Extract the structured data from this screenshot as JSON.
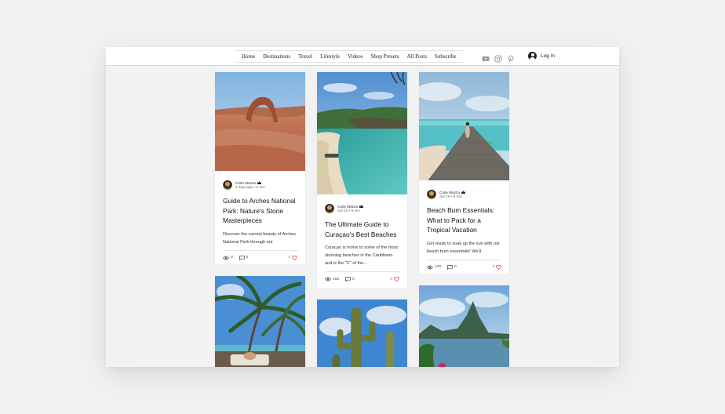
{
  "nav": {
    "items": [
      "Home",
      "Destinations",
      "Travel",
      "Lifestyle",
      "Videos",
      "Shop Presets",
      "All Posts",
      "Subscribe"
    ]
  },
  "social": [
    "youtube-icon",
    "instagram-icon",
    "pinterest-icon"
  ],
  "login": {
    "label": "Log In"
  },
  "posts": [
    {
      "author": "Corie Mazza",
      "date": "4 days ago",
      "read_time": "6 min",
      "title": "Guide to Arches National Park: Nature's Stone Masterpieces",
      "excerpt": "Discover the surreal beauty of Arches National Park through our",
      "views": "0",
      "comments": "0",
      "likes": "2"
    },
    {
      "author": "Corie Mazza",
      "date": "Apr 16",
      "read_time": "6 min",
      "title": "The Ultimate Guide to Curaçao's Best Beaches",
      "excerpt": "Curacao is home to some of the most stunning beaches in the Caribbean and is the \"C\" of the...",
      "views": "405",
      "comments": "0",
      "likes": "3"
    },
    {
      "author": "Corie Mazza",
      "date": "Apr 16",
      "read_time": "5 min",
      "title": "Beach Bum Essentials: What to Pack for a Tropical Vacation",
      "excerpt": "Get ready to soak up the sun with our beach bum essentials! We'll",
      "views": "129",
      "comments": "0",
      "likes": "3"
    }
  ],
  "meta_separator": "•",
  "colors": {
    "page_bg": "#f1f1f2",
    "card_bg": "#ffffff",
    "like_accent": "#c94b3a"
  }
}
